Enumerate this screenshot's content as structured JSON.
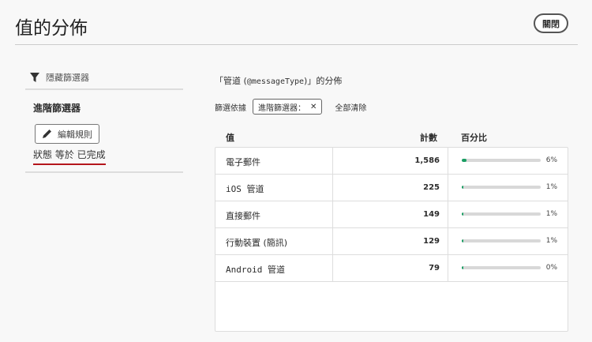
{
  "header": {
    "title": "值的分佈",
    "close_label": "關閉"
  },
  "sidebar": {
    "hide_filters": "隱藏篩選器",
    "advanced_title": "進階篩選器",
    "edit_rules": "編輯規則",
    "condition": "狀態 等於 已完成"
  },
  "main": {
    "subtitle_prefix": "「管道 (",
    "subtitle_field": "@messageType",
    "subtitle_suffix": ")」的分佈",
    "filter_by": "篩選依據",
    "filter_tag": "進階篩選器：",
    "clear_all": "全部清除",
    "columns": [
      "值",
      "計數",
      "百分比"
    ],
    "rows": [
      {
        "value": "電子郵件",
        "count": "1,586",
        "percent": "6%",
        "fraction": 0.06
      },
      {
        "value": "iOS 管道",
        "count": "225",
        "percent": "1%",
        "fraction": 0.01
      },
      {
        "value": "直接郵件",
        "count": "149",
        "percent": "1%",
        "fraction": 0.01
      },
      {
        "value": "行動裝置 (簡訊)",
        "count": "129",
        "percent": "1%",
        "fraction": 0.01
      },
      {
        "value": "Android 管道",
        "count": "79",
        "percent": "0%",
        "fraction": 0.0
      }
    ]
  },
  "colors": {
    "accent": "#1a9e63",
    "underline": "#b4151c"
  }
}
